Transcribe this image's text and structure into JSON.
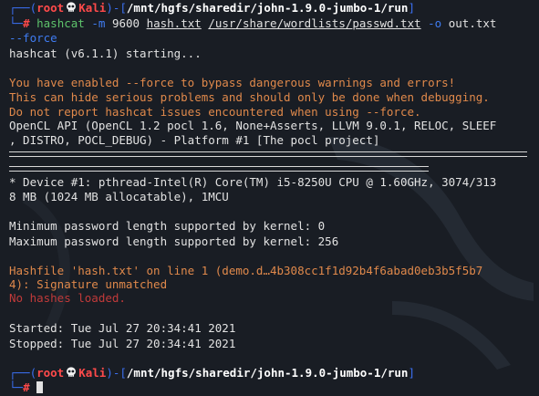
{
  "prompt": {
    "user": "root",
    "host": "Kali",
    "cwd": "/mnt/hgfs/sharedir/john-1.9.0-jumbo-1/run",
    "symbol": "#"
  },
  "command": {
    "program": "hashcat",
    "flag_m": "-m",
    "mode": "9600",
    "hashfile": "hash.txt",
    "wordlist": "/usr/share/wordlists/passwd.txt",
    "flag_o": "-o",
    "outfile": "out.txt",
    "flag_force": "--force"
  },
  "output": {
    "start_line": "hashcat (v6.1.1) starting...",
    "warn1": "You have enabled --force to bypass dangerous warnings and errors!",
    "warn2": "This can hide serious problems and should only be done when debugging.",
    "warn3": "Do not report hashcat issues encountered when using --force.",
    "opencl1": "OpenCL API (OpenCL 1.2 pocl 1.6, None+Asserts, LLVM 9.0.1, RELOC, SLEEF",
    "opencl2": ", DISTRO, POCL_DEBUG) - Platform #1 [The pocl project]",
    "device1": "* Device #1: pthread-Intel(R) Core(TM) i5-8250U CPU @ 1.60GHz, 3074/313",
    "device2": "8 MB (1024 MB allocatable), 1MCU",
    "min_pw": "Minimum password length supported by kernel: 0",
    "max_pw": "Maximum password length supported by kernel: 256",
    "hashfile1": "Hashfile 'hash.txt' on line 1 (demo.d…4b308cc1f1d92b4f6abad0eb3b5f5b7",
    "hashfile2": "4): Signature unmatched",
    "no_hashes": "No hashes loaded.",
    "started": "Started: Tue Jul 27 20:34:41 2021",
    "stopped": "Stopped: Tue Jul 27 20:34:41 2021"
  },
  "icons": {
    "skull": "skull-icon"
  },
  "colors": {
    "background": "#191d24",
    "prompt_frame": "#3b6ff0",
    "prompt_user": "#ff4a4a",
    "command": "#5ec36b",
    "flag": "#3f7cf2",
    "warning": "#e0894b",
    "error": "#c03a3a"
  }
}
